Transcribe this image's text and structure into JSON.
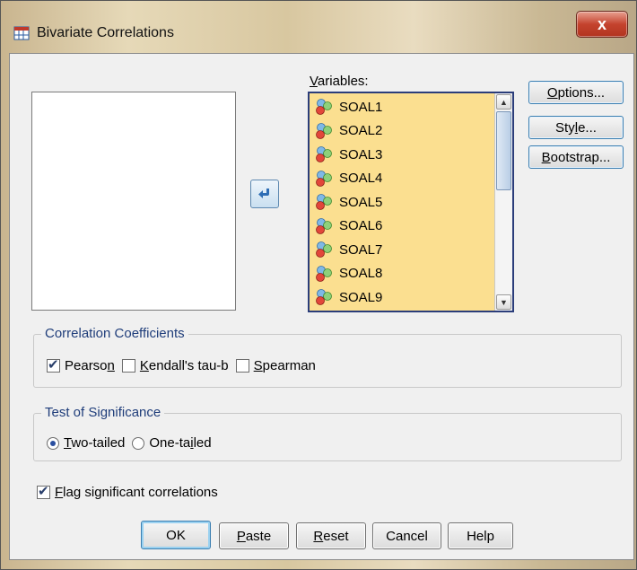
{
  "window": {
    "title": "Bivariate Correlations",
    "close_label": "x"
  },
  "variables": {
    "label": "Variables:",
    "items": [
      "SOAL1",
      "SOAL2",
      "SOAL3",
      "SOAL4",
      "SOAL5",
      "SOAL6",
      "SOAL7",
      "SOAL8",
      "SOAL9"
    ]
  },
  "side_buttons": {
    "options": "Options...",
    "style": "Style...",
    "bootstrap": "Bootstrap..."
  },
  "correlation_coefficients": {
    "legend": "Correlation Coefficients",
    "pearson": {
      "label": "Pearson",
      "checked": true
    },
    "kendall": {
      "label": "Kendall's tau-b",
      "checked": false
    },
    "spearman": {
      "label": "Spearman",
      "checked": false
    }
  },
  "test_of_significance": {
    "legend": "Test of Significance",
    "two_tailed": {
      "label": "Two-tailed",
      "selected": true
    },
    "one_tailed": {
      "label": "One-tailed",
      "selected": false
    }
  },
  "flag_significant": {
    "label": "Flag significant correlations",
    "checked": true
  },
  "bottom_buttons": {
    "ok": "OK",
    "paste": "Paste",
    "reset": "Reset",
    "cancel": "Cancel",
    "help": "Help"
  },
  "colors": {
    "variables_bg": "#fbdf90",
    "group_legend": "#1f3d7a"
  }
}
